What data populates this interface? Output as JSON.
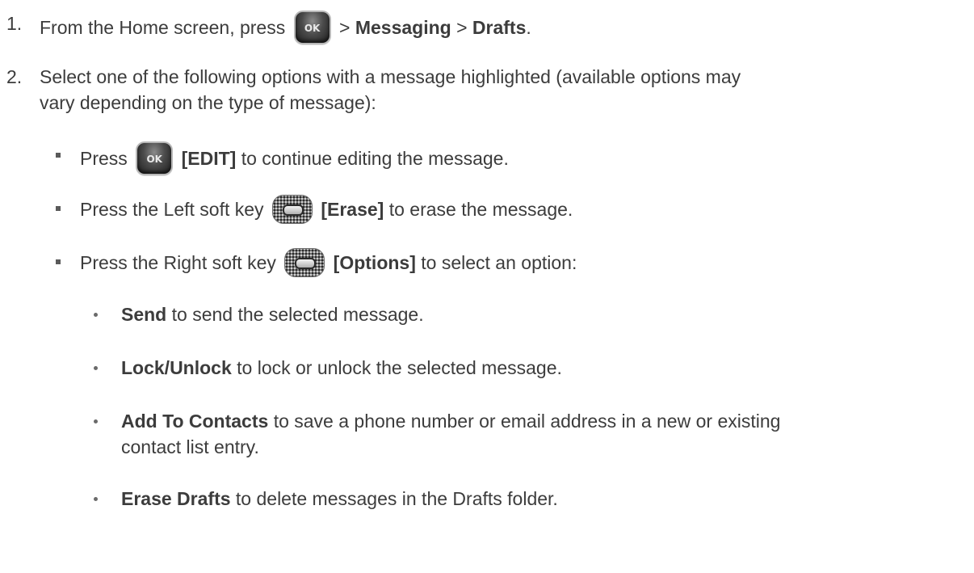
{
  "step1": {
    "number": "1.",
    "prefix": "From the Home screen, press",
    "ok_key_label": "OK",
    "sep1": ">",
    "menu1": "Messaging",
    "sep2": ">",
    "menu2": "Drafts",
    "end": "."
  },
  "step2": {
    "number": "2.",
    "line1": "Select one of the following options with a message highlighted (available options may",
    "line2": "vary depending on the type of message):"
  },
  "bullets": [
    {
      "pre": "Press",
      "key_label": "OK",
      "action": "[EDIT]",
      "post": "to continue editing the message."
    },
    {
      "pre": "Press the Left soft key",
      "action": "[Erase]",
      "post": "to erase the message."
    },
    {
      "pre": "Press the Right soft key",
      "action": "[Options]",
      "post": "to select an option:"
    }
  ],
  "options": [
    {
      "term": "Send",
      "desc": "to send the selected message."
    },
    {
      "term": "Lock/Unlock",
      "desc": "to lock or unlock the selected message."
    },
    {
      "term": "Add To Contacts",
      "desc": "to save a phone number or email address in a new or existing",
      "desc2": "contact list entry."
    },
    {
      "term": "Erase Drafts",
      "desc": "to delete messages in the Drafts folder."
    }
  ],
  "icons": {
    "ok_key": "ok-key-icon",
    "soft_key": "soft-key-icon"
  },
  "colors": {
    "text": "#3c3c3c",
    "background": "#ffffff"
  }
}
